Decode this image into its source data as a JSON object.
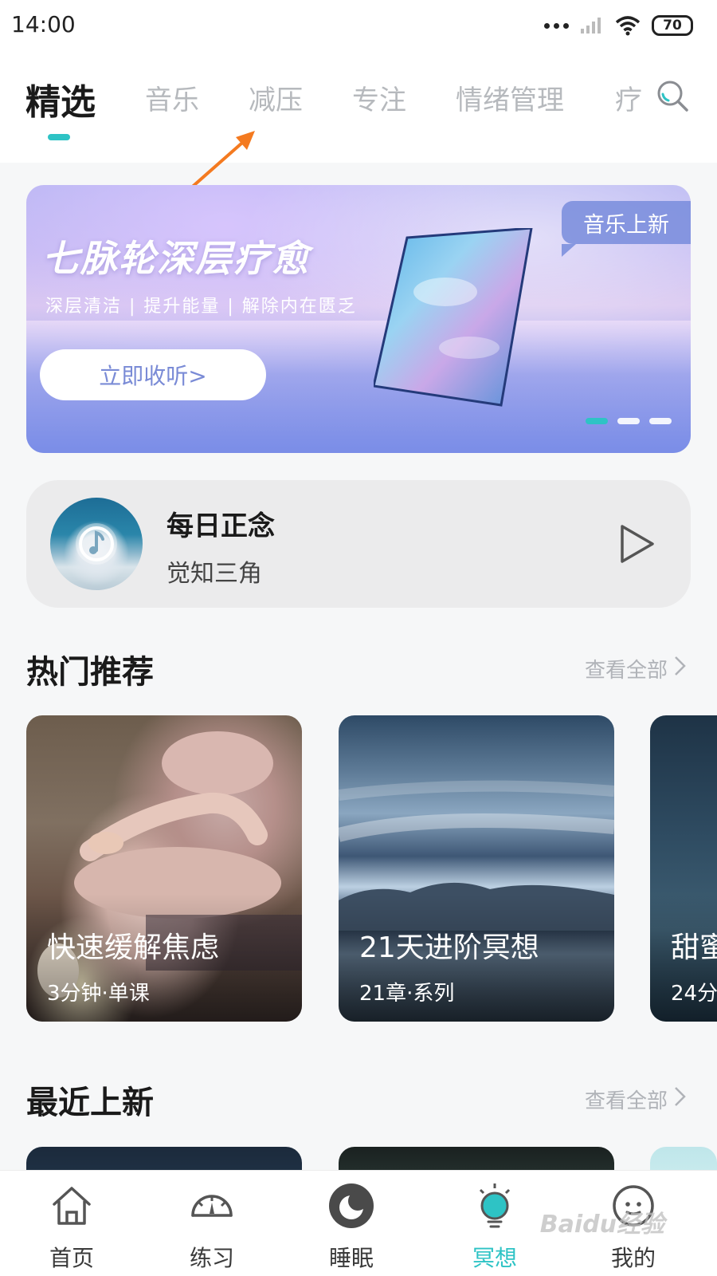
{
  "status_bar": {
    "time": "14:00",
    "battery": "70"
  },
  "tabs": [
    {
      "label": "精选",
      "active": true
    },
    {
      "label": "音乐"
    },
    {
      "label": "减压"
    },
    {
      "label": "专注"
    },
    {
      "label": "情绪管理"
    },
    {
      "label": "疗"
    }
  ],
  "banner": {
    "title": "七脉轮深层疗愈",
    "subtitle": "深层清洁 | 提升能量 | 解除内在匮乏",
    "button_label": "立即收听>",
    "badge": "音乐上新"
  },
  "daily": {
    "title": "每日正念",
    "subtitle": "觉知三角"
  },
  "hot": {
    "title": "热门推荐",
    "see_all": "查看全部",
    "cards": [
      {
        "title": "快速缓解焦虑",
        "meta": "3分钟·单课"
      },
      {
        "title": "21天进阶冥想",
        "meta": "21章·系列"
      },
      {
        "title": "甜蜜",
        "meta": "24分"
      }
    ]
  },
  "latest": {
    "title": "最近上新",
    "see_all": "查看全部"
  },
  "bottom_nav": [
    {
      "label": "首页",
      "icon": "home-icon"
    },
    {
      "label": "练习",
      "icon": "gauge-icon"
    },
    {
      "label": "睡眠",
      "icon": "moon-icon"
    },
    {
      "label": "冥想",
      "icon": "bulb-icon",
      "active": true
    },
    {
      "label": "我的",
      "icon": "face-icon"
    }
  ],
  "watermark": "Baidu经验",
  "colors": {
    "accent": "#2ec3c5",
    "annotation": "#f47a20"
  }
}
